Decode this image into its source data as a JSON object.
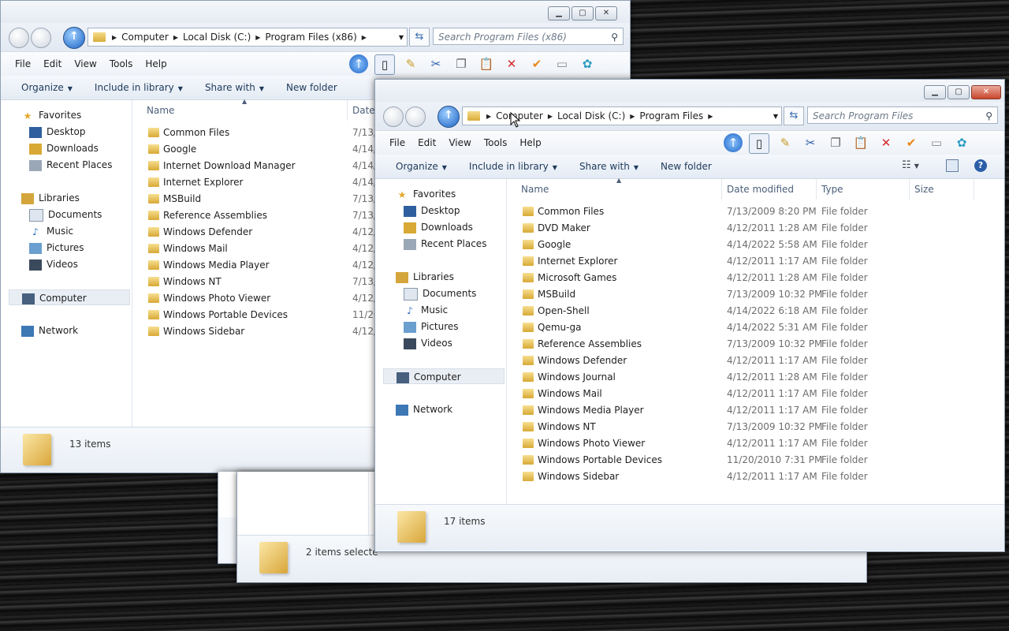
{
  "window_back": {
    "breadcrumb": [
      "Computer",
      "Local Disk (C:)",
      "Program Files (x86)"
    ],
    "search_placeholder": "Search Program Files (x86)",
    "menu": [
      "File",
      "Edit",
      "View",
      "Tools",
      "Help"
    ],
    "commands": {
      "organize": "Organize",
      "include": "Include in library",
      "share": "Share with",
      "new_folder": "New folder"
    },
    "nav": {
      "favorites": "Favorites",
      "desktop": "Desktop",
      "downloads": "Downloads",
      "recent": "Recent Places",
      "libraries": "Libraries",
      "documents": "Documents",
      "music": "Music",
      "pictures": "Pictures",
      "videos": "Videos",
      "computer": "Computer",
      "network": "Network"
    },
    "columns": {
      "name": "Name",
      "date": "Date"
    },
    "files": [
      {
        "name": "Common Files",
        "date": "7/13/"
      },
      {
        "name": "Google",
        "date": "4/14/"
      },
      {
        "name": "Internet Download Manager",
        "date": "4/14/"
      },
      {
        "name": "Internet Explorer",
        "date": "4/14/"
      },
      {
        "name": "MSBuild",
        "date": "7/13/"
      },
      {
        "name": "Reference Assemblies",
        "date": "7/13/"
      },
      {
        "name": "Windows Defender",
        "date": "4/12/"
      },
      {
        "name": "Windows Mail",
        "date": "4/12/"
      },
      {
        "name": "Windows Media Player",
        "date": "4/12/"
      },
      {
        "name": "Windows NT",
        "date": "7/13/"
      },
      {
        "name": "Windows Photo Viewer",
        "date": "4/12/"
      },
      {
        "name": "Windows Portable Devices",
        "date": "11/20"
      },
      {
        "name": "Windows Sidebar",
        "date": "4/12/"
      }
    ],
    "status": "13 items"
  },
  "window_third": {
    "status": "2 items selecte"
  },
  "window_front": {
    "breadcrumb": [
      "Computer",
      "Local Disk (C:)",
      "Program Files"
    ],
    "search_placeholder": "Search Program Files",
    "menu": [
      "File",
      "Edit",
      "View",
      "Tools",
      "Help"
    ],
    "commands": {
      "organize": "Organize",
      "include": "Include in library",
      "share": "Share with",
      "new_folder": "New folder"
    },
    "nav": {
      "favorites": "Favorites",
      "desktop": "Desktop",
      "downloads": "Downloads",
      "recent": "Recent Places",
      "libraries": "Libraries",
      "documents": "Documents",
      "music": "Music",
      "pictures": "Pictures",
      "videos": "Videos",
      "computer": "Computer",
      "network": "Network"
    },
    "columns": {
      "name": "Name",
      "date": "Date modified",
      "type": "Type",
      "size": "Size"
    },
    "files": [
      {
        "name": "Common Files",
        "date": "7/13/2009 8:20 PM",
        "type": "File folder"
      },
      {
        "name": "DVD Maker",
        "date": "4/12/2011 1:28 AM",
        "type": "File folder"
      },
      {
        "name": "Google",
        "date": "4/14/2022 5:58 AM",
        "type": "File folder"
      },
      {
        "name": "Internet Explorer",
        "date": "4/12/2011 1:17 AM",
        "type": "File folder"
      },
      {
        "name": "Microsoft Games",
        "date": "4/12/2011 1:28 AM",
        "type": "File folder"
      },
      {
        "name": "MSBuild",
        "date": "7/13/2009 10:32 PM",
        "type": "File folder"
      },
      {
        "name": "Open-Shell",
        "date": "4/14/2022 6:18 AM",
        "type": "File folder"
      },
      {
        "name": "Qemu-ga",
        "date": "4/14/2022 5:31 AM",
        "type": "File folder"
      },
      {
        "name": "Reference Assemblies",
        "date": "7/13/2009 10:32 PM",
        "type": "File folder"
      },
      {
        "name": "Windows Defender",
        "date": "4/12/2011 1:17 AM",
        "type": "File folder"
      },
      {
        "name": "Windows Journal",
        "date": "4/12/2011 1:28 AM",
        "type": "File folder"
      },
      {
        "name": "Windows Mail",
        "date": "4/12/2011 1:17 AM",
        "type": "File folder"
      },
      {
        "name": "Windows Media Player",
        "date": "4/12/2011 1:17 AM",
        "type": "File folder"
      },
      {
        "name": "Windows NT",
        "date": "7/13/2009 10:32 PM",
        "type": "File folder"
      },
      {
        "name": "Windows Photo Viewer",
        "date": "4/12/2011 1:17 AM",
        "type": "File folder"
      },
      {
        "name": "Windows Portable Devices",
        "date": "11/20/2010 7:31 PM",
        "type": "File folder"
      },
      {
        "name": "Windows Sidebar",
        "date": "4/12/2011 1:17 AM",
        "type": "File folder"
      }
    ],
    "status": "17 items"
  },
  "icons": {
    "favorites": "star-icon",
    "up": "up-arrow-icon",
    "search": "magnifier-icon",
    "cut": "scissors-icon",
    "delete": "red-x-icon",
    "check": "checkmark-icon",
    "help": "question-icon"
  },
  "colors": {
    "accent": "#1c62c4",
    "close": "#c9462c",
    "folder": "#d8a935"
  }
}
